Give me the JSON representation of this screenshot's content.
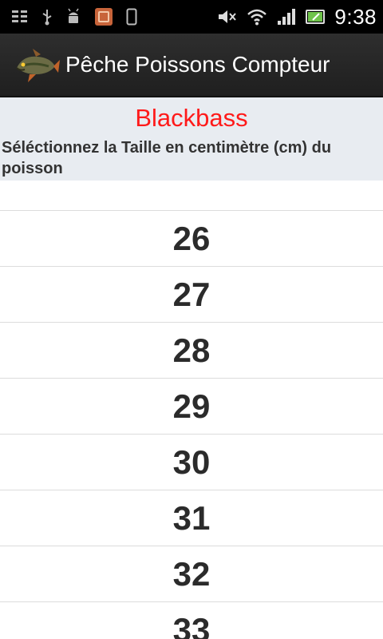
{
  "status_bar": {
    "time": "9:38",
    "icons": [
      "notification-list-icon",
      "usb-icon",
      "android-debug-icon",
      "sd-card-icon",
      "phone-icon",
      "mute-icon",
      "wifi-icon",
      "signal-icon",
      "battery-icon"
    ]
  },
  "action_bar": {
    "title": "Pêche Poissons Compteur",
    "icon": "fish-logo-icon"
  },
  "header": {
    "fish_name": "Blackbass",
    "instruction": "Séléctionnez la Taille en centimètre (cm) du poisson"
  },
  "size_list": {
    "items": [
      "26",
      "27",
      "28",
      "29",
      "30",
      "31",
      "32",
      "33"
    ]
  },
  "colors": {
    "status_bar_bg": "#000000",
    "action_bar_bg": "#262626",
    "header_bg": "#e8ecf1",
    "fish_name": "#ff1a1a",
    "divider": "#dcdcdc"
  }
}
